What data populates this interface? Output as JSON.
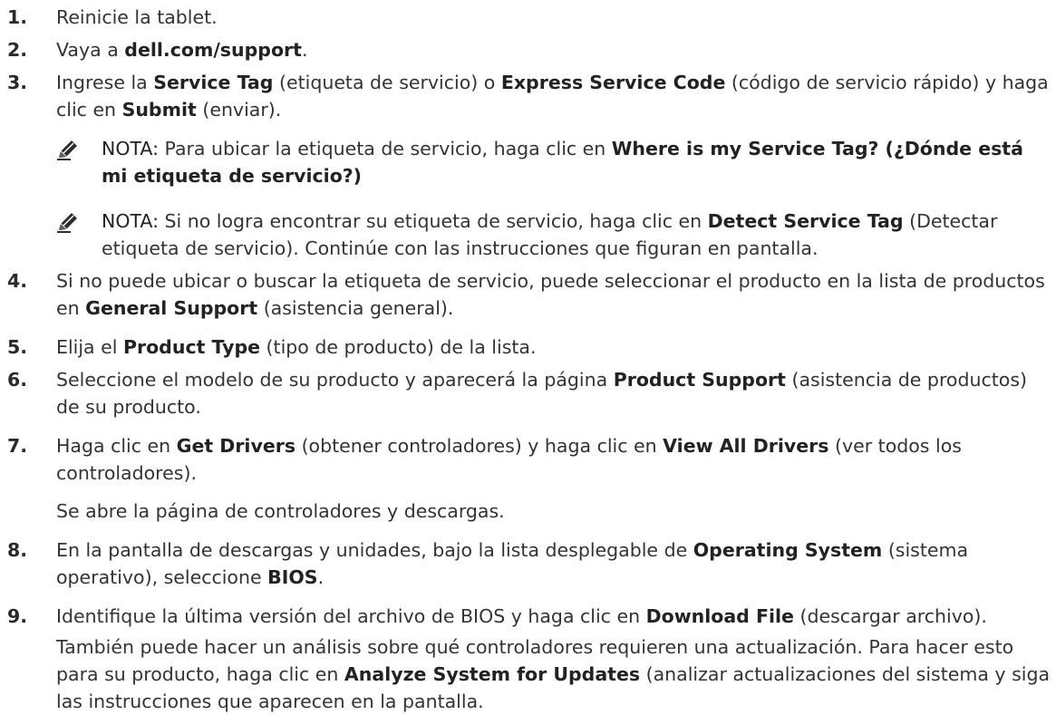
{
  "steps": [
    {
      "num": "1.",
      "parts": [
        {
          "t": "Reinicie la tablet."
        }
      ]
    },
    {
      "num": "2.",
      "parts": [
        {
          "t": "Vaya a "
        },
        {
          "t": "dell.com/support",
          "b": true
        },
        {
          "t": "."
        }
      ]
    },
    {
      "num": "3.",
      "parts": [
        {
          "t": "Ingrese la "
        },
        {
          "t": "Service Tag",
          "b": true
        },
        {
          "t": " (etiqueta de servicio) o "
        },
        {
          "t": "Express Service Code",
          "b": true
        },
        {
          "t": " (código de servicio rápido) y haga clic en "
        },
        {
          "t": "Submit",
          "b": true
        },
        {
          "t": " (enviar)."
        }
      ]
    },
    {
      "num": "4.",
      "parts": [
        {
          "t": "Si no puede ubicar o buscar la etiqueta de servicio, puede seleccionar el producto en la lista de productos en "
        },
        {
          "t": "General Support",
          "b": true
        },
        {
          "t": " (asistencia general)."
        }
      ]
    },
    {
      "num": "5.",
      "parts": [
        {
          "t": "Elija el "
        },
        {
          "t": "Product Type",
          "b": true
        },
        {
          "t": " (tipo de producto) de la lista."
        }
      ]
    },
    {
      "num": "6.",
      "parts": [
        {
          "t": "Seleccione el modelo de su producto y aparecerá la página "
        },
        {
          "t": "Product Support",
          "b": true
        },
        {
          "t": " (asistencia de productos) de su producto."
        }
      ]
    },
    {
      "num": "7.",
      "parts": [
        {
          "t": "Haga clic en "
        },
        {
          "t": "Get Drivers",
          "b": true
        },
        {
          "t": " (obtener controladores) y haga clic en "
        },
        {
          "t": "View All Drivers",
          "b": true
        },
        {
          "t": " (ver todos los controladores)."
        }
      ]
    },
    {
      "num": "8.",
      "parts": [
        {
          "t": "En la pantalla de descargas y unidades, bajo la lista desplegable de "
        },
        {
          "t": "Operating System",
          "b": true
        },
        {
          "t": " (sistema operativo), seleccione "
        },
        {
          "t": "BIOS",
          "b": true
        },
        {
          "t": "."
        }
      ]
    },
    {
      "num": "9.",
      "parts": [
        {
          "t": "Identifique la última versión del archivo de BIOS y haga clic en "
        },
        {
          "t": "Download File",
          "b": true
        },
        {
          "t": " (descargar archivo)."
        }
      ]
    }
  ],
  "notes": [
    {
      "label": "NOTA:",
      "parts": [
        {
          "t": " Para ubicar la etiqueta de servicio, haga clic en "
        },
        {
          "t": "Where is my Service Tag? (¿Dónde está mi etiqueta de servicio?)",
          "b": true
        }
      ]
    },
    {
      "label": "NOTA:",
      "parts": [
        {
          "t": " Si no logra encontrar su etiqueta de servicio, haga clic en "
        },
        {
          "t": "Detect Service Tag",
          "b": true
        },
        {
          "t": " (Detectar etiqueta de servicio). Continúe con las instrucciones que figuran en pantalla."
        }
      ]
    }
  ],
  "step7_result": "Se abre la página de controladores y descargas.",
  "step9_followup": [
    {
      "t": "También puede hacer un análisis sobre qué controladores requieren una actualización. Para hacer esto para su producto, haga clic en "
    },
    {
      "t": "Analyze System for Updates",
      "b": true
    },
    {
      "t": " (analizar actualizaciones del sistema y siga las instrucciones que aparecen en la pantalla."
    }
  ],
  "icons": {
    "note": "pencil-note-icon"
  }
}
